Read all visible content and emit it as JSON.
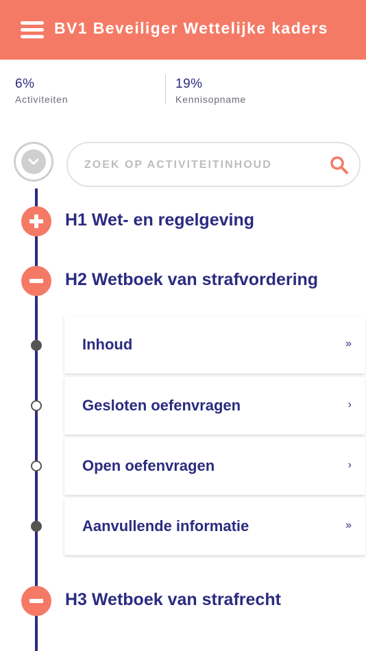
{
  "header": {
    "title": "BV1 Beveiliger Wettelijke kaders",
    "menu_icon": "hamburger-menu-icon",
    "background_color": "#f47a66"
  },
  "stats": [
    {
      "value": "6%",
      "label": "Activiteiten"
    },
    {
      "value": "19%",
      "label": "Kennisopname"
    }
  ],
  "search": {
    "placeholder": "ZOEK OP ACTIVITEITINHOUD",
    "value": "",
    "icon": "search-icon"
  },
  "chapters": [
    {
      "title": "H1 Wet- en regelgeving",
      "state": "collapsed",
      "icon": "plus-icon"
    },
    {
      "title": "H2 Wetboek van strafvordering",
      "state": "expanded",
      "icon": "minus-icon",
      "items": [
        {
          "label": "Inhoud",
          "chevron": "»",
          "completed": true
        },
        {
          "label": "Gesloten oefenvragen",
          "chevron": "›",
          "completed": false
        },
        {
          "label": "Open oefenvragen",
          "chevron": "›",
          "completed": false
        },
        {
          "label": "Aanvullende informatie",
          "chevron": "»",
          "completed": true
        }
      ]
    },
    {
      "title": "H3 Wetboek van strafrecht",
      "state": "expanded",
      "icon": "minus-icon"
    }
  ],
  "colors": {
    "accent": "#f47a66",
    "text_primary": "#2b2b80",
    "timeline": "#2b2b80",
    "node_filled": "#555555"
  }
}
